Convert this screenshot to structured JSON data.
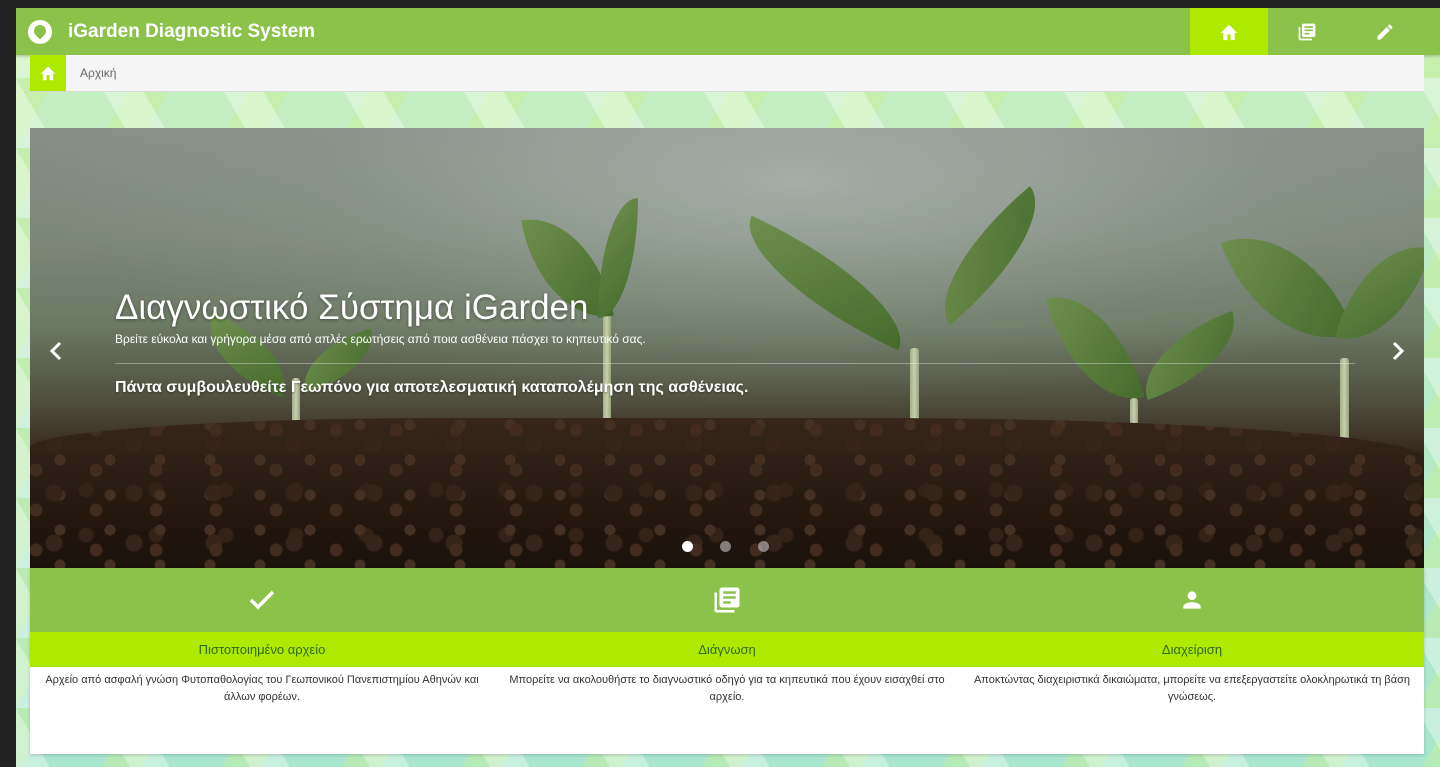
{
  "app": {
    "title": "iGarden Diagnostic System",
    "logo_icon": "seedling-logo-icon"
  },
  "nav": {
    "items": [
      {
        "name": "home",
        "icon": "home-icon",
        "active": true
      },
      {
        "name": "library",
        "icon": "library-books-icon",
        "active": false
      },
      {
        "name": "edit",
        "icon": "pencil-icon",
        "active": false
      }
    ]
  },
  "breadcrumb": {
    "icon": "home-icon",
    "label": "Αρχική"
  },
  "carousel": {
    "title": "Διαγνωστικό Σύστημα iGarden",
    "subtitle": "Βρείτε εύκολα και γρήγορα μέσα από απλές ερωτήσεις από ποια ασθένεια πάσχει το κηπευτικό σας.",
    "notice": "Πάντα συμβουλευθείτε Γεωπόνο για αποτελεσματική καταπολέμηση της ασθένειας.",
    "prev_icon": "chevron-left-icon",
    "next_icon": "chevron-right-icon",
    "slide_count": 3,
    "active_slide": 1
  },
  "features": [
    {
      "icon": "check-icon",
      "label": "Πιστοποιημένο αρχείο",
      "description": "Αρχείο από ασφαλή γνώση Φυτοπαθολογίας του Γεωπονικού Πανεπιστημίου Αθηνών και άλλων φορέων."
    },
    {
      "icon": "library-books-icon",
      "label": "Διάγνωση",
      "description": "Μπορείτε να ακολουθήστε το διαγνωστικό οδηγό για τα κηπευτικά που έχουν εισαχθεί στο αρχείο."
    },
    {
      "icon": "person-icon",
      "label": "Διαχείριση",
      "description": "Αποκτώντας διαχειριστικά δικαιώματα, μπορείτε να επεξεργαστείτε ολοκληρωτικά τη βάση γνώσεως."
    }
  ],
  "colors": {
    "primary": "#8bc34a",
    "accent": "#aeea00",
    "label_text": "#33691e"
  }
}
